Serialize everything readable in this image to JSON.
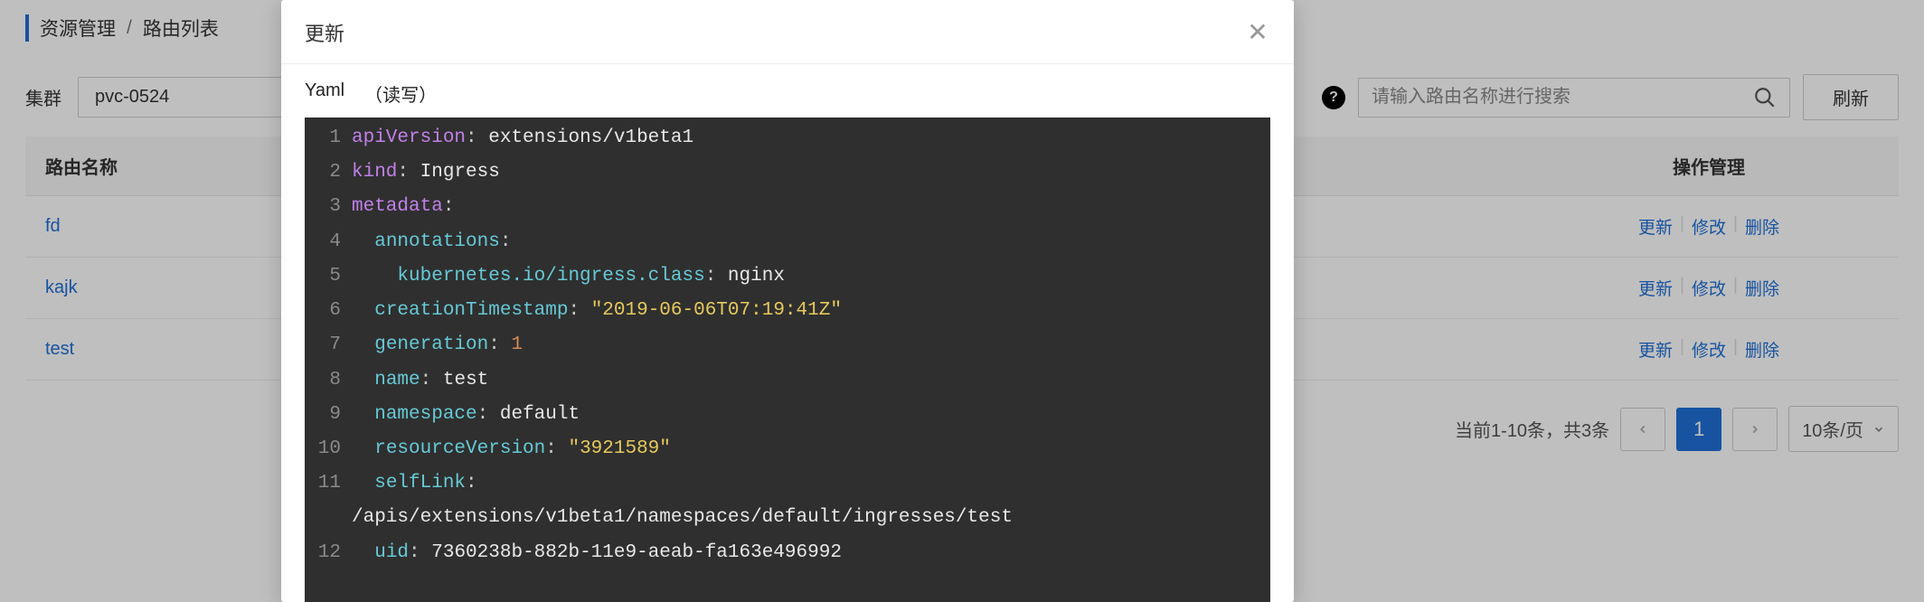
{
  "breadcrumb": {
    "root": "资源管理",
    "sep": "/",
    "current": "路由列表"
  },
  "toolbar": {
    "cluster_label": "集群",
    "cluster_value": "pvc-0524",
    "refresh_label": "刷新"
  },
  "search": {
    "placeholder": "请输入路由名称进行搜索"
  },
  "table": {
    "col_name": "路由名称",
    "col_ops": "操作管理",
    "rows": [
      {
        "name": "fd"
      },
      {
        "name": "kajk"
      },
      {
        "name": "test"
      }
    ],
    "ops": {
      "update": "更新",
      "edit": "修改",
      "delete": "删除"
    }
  },
  "pagination": {
    "summary": "当前1-10条，共3条",
    "page": "1",
    "size_label": "10条/页"
  },
  "modal": {
    "title": "更新",
    "tab_yaml": "Yaml",
    "mode": "（读写）"
  },
  "yaml": {
    "lines": [
      {
        "n": "1",
        "segments": [
          {
            "c": "tok-key",
            "t": "apiVersion"
          },
          {
            "c": "tok-punc",
            "t": ": "
          },
          {
            "c": "tok-plain",
            "t": "extensions/v1beta1"
          }
        ]
      },
      {
        "n": "2",
        "segments": [
          {
            "c": "tok-key",
            "t": "kind"
          },
          {
            "c": "tok-punc",
            "t": ": "
          },
          {
            "c": "tok-plain",
            "t": "Ingress"
          }
        ]
      },
      {
        "n": "3",
        "segments": [
          {
            "c": "tok-key",
            "t": "metadata"
          },
          {
            "c": "tok-punc",
            "t": ":"
          }
        ]
      },
      {
        "n": "4",
        "segments": [
          {
            "c": "tok-plain",
            "t": "  "
          },
          {
            "c": "tok-skey",
            "t": "annotations"
          },
          {
            "c": "tok-punc",
            "t": ":"
          }
        ]
      },
      {
        "n": "5",
        "segments": [
          {
            "c": "tok-plain",
            "t": "    "
          },
          {
            "c": "tok-skey",
            "t": "kubernetes.io/ingress.class"
          },
          {
            "c": "tok-punc",
            "t": ": "
          },
          {
            "c": "tok-plain",
            "t": "nginx"
          }
        ]
      },
      {
        "n": "6",
        "segments": [
          {
            "c": "tok-plain",
            "t": "  "
          },
          {
            "c": "tok-skey",
            "t": "creationTimestamp"
          },
          {
            "c": "tok-punc",
            "t": ": "
          },
          {
            "c": "tok-str",
            "t": "\"2019-06-06T07:19:41Z\""
          }
        ]
      },
      {
        "n": "7",
        "segments": [
          {
            "c": "tok-plain",
            "t": "  "
          },
          {
            "c": "tok-skey",
            "t": "generation"
          },
          {
            "c": "tok-punc",
            "t": ": "
          },
          {
            "c": "tok-num",
            "t": "1"
          }
        ]
      },
      {
        "n": "8",
        "segments": [
          {
            "c": "tok-plain",
            "t": "  "
          },
          {
            "c": "tok-skey",
            "t": "name"
          },
          {
            "c": "tok-punc",
            "t": ": "
          },
          {
            "c": "tok-plain",
            "t": "test"
          }
        ]
      },
      {
        "n": "9",
        "segments": [
          {
            "c": "tok-plain",
            "t": "  "
          },
          {
            "c": "tok-skey",
            "t": "namespace"
          },
          {
            "c": "tok-punc",
            "t": ": "
          },
          {
            "c": "tok-plain",
            "t": "default"
          }
        ]
      },
      {
        "n": "10",
        "segments": [
          {
            "c": "tok-plain",
            "t": "  "
          },
          {
            "c": "tok-skey",
            "t": "resourceVersion"
          },
          {
            "c": "tok-punc",
            "t": ": "
          },
          {
            "c": "tok-str",
            "t": "\"3921589\""
          }
        ]
      },
      {
        "n": "11",
        "segments": [
          {
            "c": "tok-plain",
            "t": "  "
          },
          {
            "c": "tok-skey",
            "t": "selfLink"
          },
          {
            "c": "tok-punc",
            "t": ":"
          }
        ]
      },
      {
        "n": "",
        "segments": [
          {
            "c": "tok-plain",
            "t": "/apis/extensions/v1beta1/namespaces/default/ingresses/test"
          }
        ]
      },
      {
        "n": "12",
        "segments": [
          {
            "c": "tok-plain",
            "t": "  "
          },
          {
            "c": "tok-skey",
            "t": "uid"
          },
          {
            "c": "tok-punc",
            "t": ": "
          },
          {
            "c": "tok-plain",
            "t": "7360238b-882b-11e9-aeab-fa163e496992"
          }
        ]
      }
    ]
  }
}
